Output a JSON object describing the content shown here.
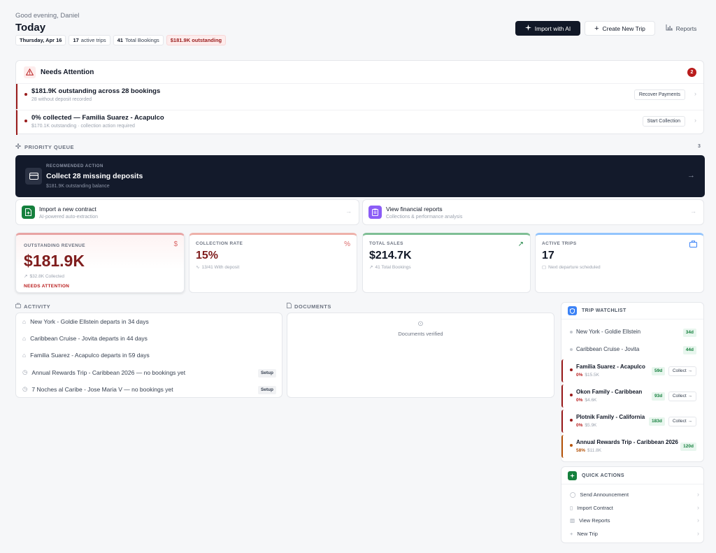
{
  "header": {
    "greeting": "Good evening, Daniel",
    "title": "Today",
    "chips": {
      "date": "Thursday, Apr 16",
      "active_trips_count": "17",
      "active_trips_label": "active trips",
      "bookings_count": "41",
      "bookings_label": "Total Bookings",
      "outstanding": "$181.9K outstanding"
    },
    "import_ai": "Import with AI",
    "create_trip": "Create New Trip",
    "reports": "Reports"
  },
  "attention": {
    "title": "Needs Attention",
    "count": "2",
    "items": [
      {
        "headline": "$181.9K outstanding across 28 bookings",
        "sub": "28 without deposit recorded",
        "action": "Recover Payments"
      },
      {
        "headline": "0% collected — Familia Suarez - Acapulco",
        "sub": "$170.1K outstanding · collection action required",
        "action": "Start Collection"
      }
    ]
  },
  "priority": {
    "label": "PRIORITY QUEUE",
    "count": "3",
    "recommended": {
      "kicker": "RECOMMENDED ACTION",
      "headline": "Collect 28 missing deposits",
      "sub": "$181.9K outstanding balance"
    },
    "secondary": [
      {
        "headline": "Import a new contract",
        "sub": "AI-powered auto-extraction"
      },
      {
        "headline": "View financial reports",
        "sub": "Collections & performance analysis"
      }
    ]
  },
  "kpis": {
    "outstanding": {
      "label": "OUTSTANDING REVENUE",
      "value": "$181.9K",
      "sub": "$32.8K Collected",
      "flag": "NEEDS ATTENTION"
    },
    "collection": {
      "label": "COLLECTION RATE",
      "value": "15%",
      "sub": "13/41 With deposit"
    },
    "sales": {
      "label": "TOTAL SALES",
      "value": "$214.7K",
      "sub": "41 Total Bookings"
    },
    "trips": {
      "label": "ACTIVE TRIPS",
      "value": "17",
      "sub": "Next departure scheduled"
    }
  },
  "activity": {
    "label": "ACTIVITY",
    "items": [
      {
        "text": "New York - Goldie Ellstein departs in 34 days",
        "tag": ""
      },
      {
        "text": "Caribbean Cruise - Jovita departs in 44 days",
        "tag": ""
      },
      {
        "text": "Familia Suarez - Acapulco departs in 59 days",
        "tag": ""
      },
      {
        "text": "Annual Rewards Trip - Caribbean 2026 — no bookings yet",
        "tag": "Setup"
      },
      {
        "text": "7 Noches al Caribe - Jose Maria V — no bookings yet",
        "tag": "Setup"
      }
    ]
  },
  "documents": {
    "label": "DOCUMENTS",
    "status": "Documents verified"
  },
  "watchlist": {
    "title": "TRIP WATCHLIST",
    "collect_label": "Collect →",
    "items": [
      {
        "name": "New York - Goldie Ellstein",
        "days": "34d"
      },
      {
        "name": "Caribbean Cruise - Jovita",
        "days": "44d"
      },
      {
        "name": "Familia Suarez - Acapulco",
        "days": "59d",
        "pct": "0%",
        "amount": "$15.5K"
      },
      {
        "name": "Okon Family - Caribbean",
        "days": "93d",
        "pct": "0%",
        "amount": "$4.6K"
      },
      {
        "name": "Plotnik Family - California",
        "days": "183d",
        "pct": "0%",
        "amount": "$5.9K"
      },
      {
        "name": "Annual Rewards Trip - Caribbean 2026",
        "days": "120d",
        "pct": "58%",
        "amount": "$11.8K"
      }
    ]
  },
  "quick_actions": {
    "title": "QUICK ACTIONS",
    "items": [
      "Send Announcement",
      "Import Contract",
      "View Reports",
      "New Trip"
    ]
  },
  "colors": {
    "danger": "#991b1b",
    "dark": "#131a2b",
    "success": "#15803d",
    "warning": "#b45309",
    "info": "#3b82f6"
  }
}
